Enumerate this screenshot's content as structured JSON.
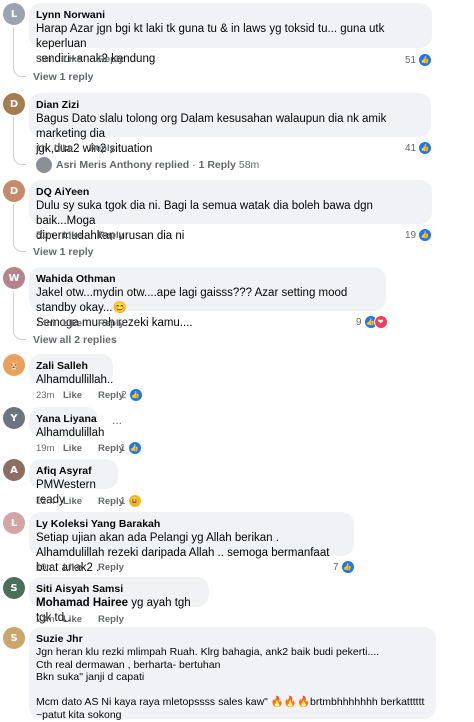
{
  "comments": [
    {
      "name": "Lynn Norwani",
      "text": "Harap Azar jgn bgi kt laki tk guna tu & in laws yg toksid tu... guna utk keperluan\nsendiri+anak2 kandung",
      "time": "39m",
      "like": "Like",
      "reply": "Reply",
      "count": "51",
      "view": "View 1 reply"
    },
    {
      "name": "Dian Zizi",
      "text": "Bagus Dato slalu tolong org Dalam kesusahan walaupun dia nk amik marketing dia\njgk,dua2 win2 situation",
      "time": "1h",
      "like": "Like",
      "reply": "Reply",
      "count": "41",
      "reply_author": "Asri Meris Anthony",
      "reply_action": "replied",
      "reply_dot": "·",
      "reply_count": "1 Reply",
      "reply_time": "58m"
    },
    {
      "name": "DQ AiYeen",
      "text": "Dulu sy suka tgok dia ni. Bagi la semua watak dia boleh bawa dgn baik...Moga\ndipermudahkan urusan dia ni",
      "time": "51m",
      "like": "Like",
      "reply": "Reply",
      "count": "19",
      "view": "View 1 reply"
    },
    {
      "name": "Wahida Othman",
      "text": "Jakel otw...mydin otw....ape lagi gaisss??? Azar setting mood standby okay...😊\nSemoga murah rezeki kamu....",
      "time": "14m",
      "like": "Like",
      "reply": "Reply",
      "count": "9",
      "view": "View all 2 replies"
    },
    {
      "name": "Zali Salleh",
      "text": "Alhamdullillah..",
      "time": "23m",
      "like": "Like",
      "reply": "Reply",
      "count": "2"
    },
    {
      "name": "Yana Liyana",
      "text": "Alhamdulillah",
      "time": "19m",
      "like": "Like",
      "reply": "Reply",
      "count": "1",
      "more": "..."
    },
    {
      "name": "Afiq Asyraf",
      "text": "PMWestern ready",
      "time": "12m",
      "like": "Like",
      "reply": "Reply",
      "count": "1"
    },
    {
      "name": "Ly Koleksi Yang Barakah",
      "text": "Setiap ujian akan ada Pelangi yg Allah berikan .\nAlhamdulillah rezeki daripada Allah .. semoga bermanfaat buat anak2 .",
      "time": "19m",
      "like": "Like",
      "reply": "Reply",
      "count": "7"
    },
    {
      "name": "Siti Aisyah Samsi",
      "tag": "Mohamad Hairee",
      "text": " yg ayah tgh tgk td..",
      "time": "23m",
      "like": "Like",
      "reply": "Reply"
    },
    {
      "name": "Suzie Jhr",
      "text": "Jgn heran klu rezki mlimpah Ruah. Klrg bahagia, ank2 baik budi pekerti....\nCth real dermawan , berharta- bertuhan\nBkn suka\" janji d capati\n\nMcm dato AS Ni kaya raya mletopssss sales kaw\" 🔥🔥🔥brtmbhhhhhhh berkatttttt\n~patut kita sokong"
    }
  ],
  "colors": {
    "like": "#1877f2",
    "heart": "#f33e58",
    "haha": "#f7b125",
    "bubble": "#f0f2f5",
    "meta": "#65676b"
  }
}
